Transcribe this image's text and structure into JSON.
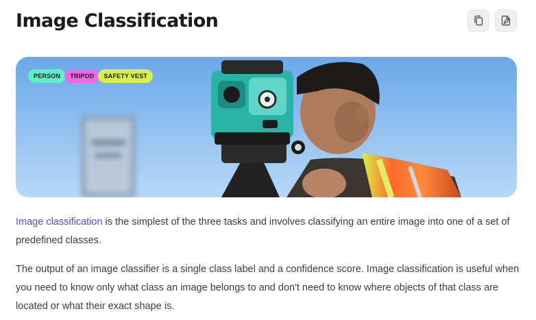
{
  "header": {
    "title": "Image Classification",
    "copy_icon": "copy-icon",
    "edit_icon": "edit-document-icon"
  },
  "hero": {
    "tags": [
      {
        "label": "PERSON",
        "color": "#5ef0c7"
      },
      {
        "label": "TRIPOD",
        "color": "#f067e8"
      },
      {
        "label": "SAFETY VEST",
        "color": "#d9f04a"
      }
    ]
  },
  "content": {
    "p1_link": "Image classification",
    "p1_rest": " is the simplest of the three tasks and involves classifying an entire image into one of a set of predefined classes.",
    "p2": "The output of an image classifier is a single class label and a confidence score. Image classification is useful when you need to know only what class an image belongs to and don't need to know where objects of that class are located or what their exact shape is."
  },
  "colors": {
    "link": "#4a4fd6",
    "sky_top": "#6aa8e8",
    "sky_bottom": "#b8d8f7"
  }
}
